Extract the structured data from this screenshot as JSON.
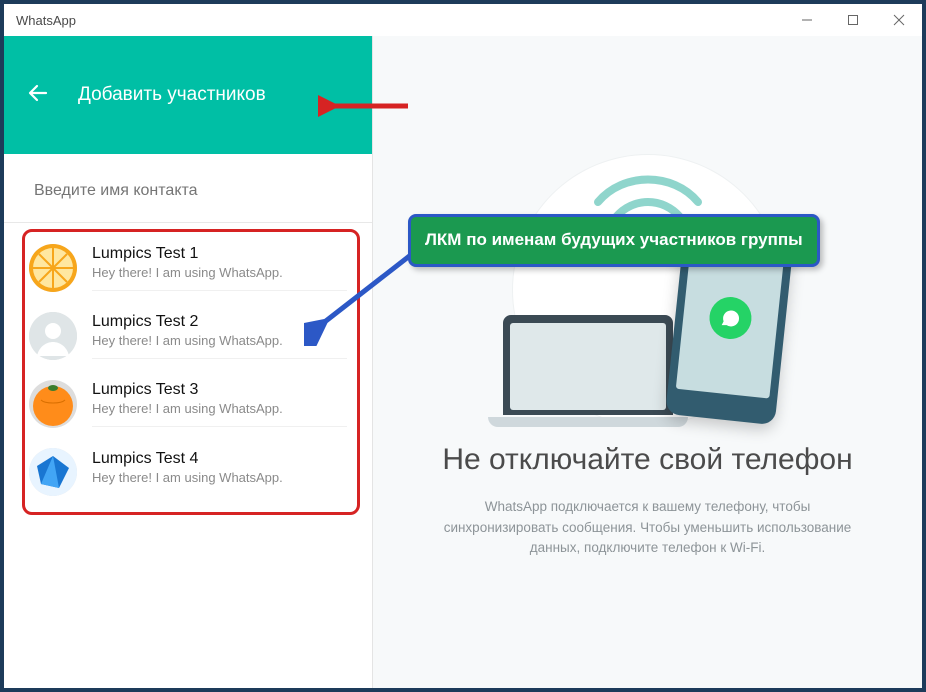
{
  "window": {
    "title": "WhatsApp"
  },
  "sidebar": {
    "title": "Добавить участников",
    "search_placeholder": "Введите имя контакта",
    "contacts": [
      {
        "name": "Lumpics Test 1",
        "status": "Hey there! I am using WhatsApp.",
        "avatar": "orange-slice"
      },
      {
        "name": "Lumpics Test 2",
        "status": "Hey there! I am using WhatsApp.",
        "avatar": "default"
      },
      {
        "name": "Lumpics Test 3",
        "status": "Hey there! I am using WhatsApp.",
        "avatar": "orange-whole"
      },
      {
        "name": "Lumpics Test 4",
        "status": "Hey there! I am using WhatsApp.",
        "avatar": "blue-gem"
      }
    ]
  },
  "main": {
    "title": "Не отключайте свой телефон",
    "subtitle": "WhatsApp подключается к вашему телефону, чтобы синхронизировать сообщения. Чтобы уменьшить использование данных, подключите телефон к Wi-Fi."
  },
  "annotation": {
    "callout": "ЛКМ по именам будущих участников группы"
  },
  "colors": {
    "teal": "#00bfa5",
    "highlight_red": "#d62323",
    "callout_bg": "#1b9950",
    "callout_border": "#2c58c6"
  }
}
